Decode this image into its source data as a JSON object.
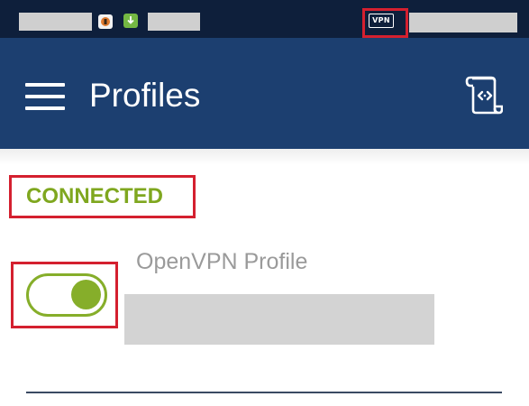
{
  "status_bar": {
    "vpn_badge": "VPN",
    "icons": [
      "app-notification-icon",
      "download-icon"
    ]
  },
  "app_bar": {
    "title": "Profiles",
    "menu_icon": "hamburger-menu-icon",
    "action_icon": "import-profile-icon"
  },
  "profile": {
    "status": "CONNECTED",
    "name": "OpenVPN Profile",
    "connected": true
  },
  "colors": {
    "status_bar": "#0e1f3b",
    "app_bar": "#1c3f70",
    "connected_green": "#86ae2a",
    "highlight_red": "#d4202f"
  }
}
